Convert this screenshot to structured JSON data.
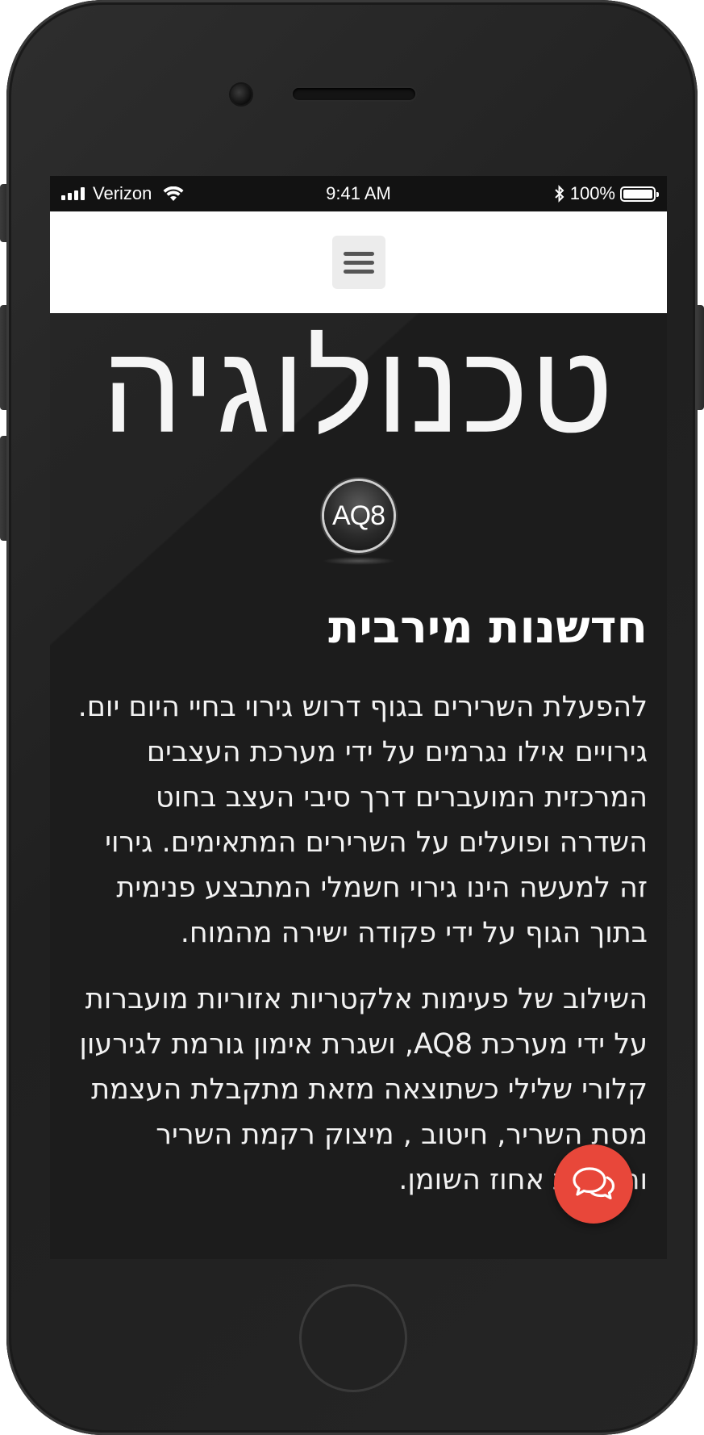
{
  "status_bar": {
    "carrier": "Verizon",
    "time": "9:41 AM",
    "battery_percent": "100%",
    "battery_level": 1.0
  },
  "nav": {
    "menu_icon": "hamburger-menu-icon"
  },
  "hero": {
    "title": "טכנולוגיה",
    "logo_text": "AQ8"
  },
  "section": {
    "title": "חדשנות מירבית",
    "paragraph_1": "להפעלת השרירים בגוף דרוש גירוי בחיי היום יום. גירויים אילו נגרמים על ידי מערכת העצבים המרכזית המועברים דרך סיבי העצב בחוט השדרה ופועלים על השרירים המתאימים. גירוי זה למעשה הינו גירוי חשמלי המתבצע פנימית בתוך הגוף על ידי פקודה ישירה מהמוח.",
    "paragraph_2": "השילוב של פעימות אלקטריות אזוריות מועברות על ידי מערכת AQ8, ושגרת אימון גורמת לגירעון קלורי שלילי כשתוצאה מזאת מתקבלת העצמת מסת השריר, חיטוב , מיצוק רקמת השריר והקטנת אחוז השומן."
  },
  "chat": {
    "icon": "chat-bubbles-icon",
    "color": "#e8473a"
  }
}
